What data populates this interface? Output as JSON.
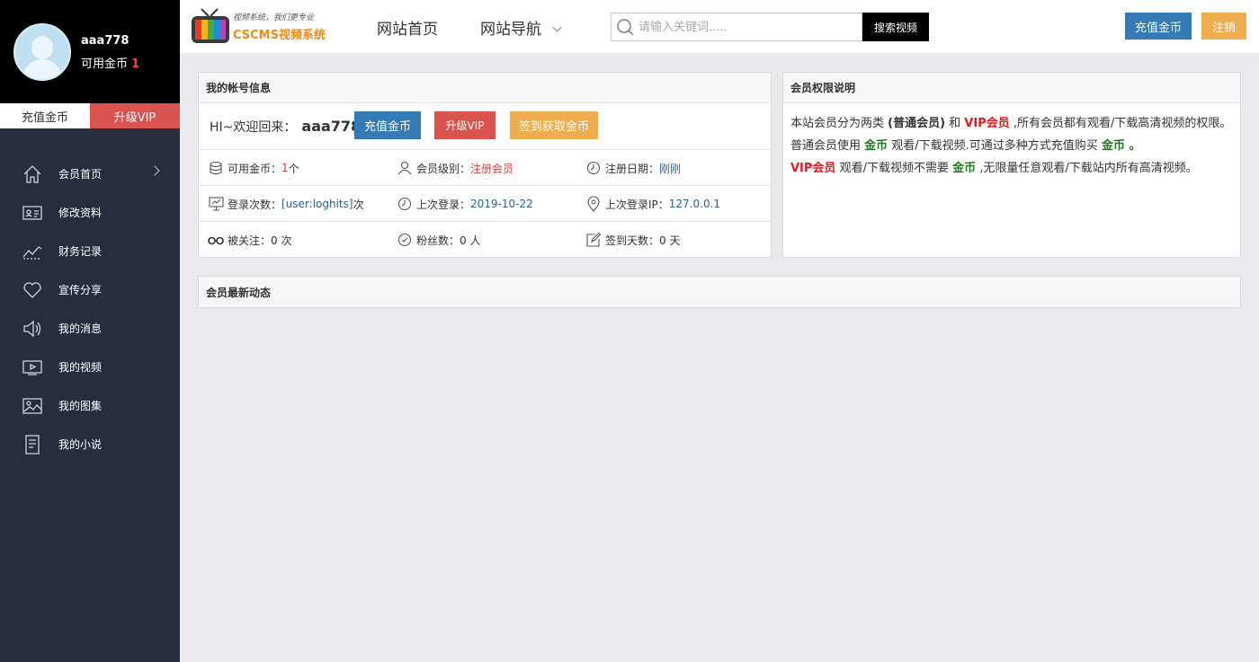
{
  "sidebar": {
    "username": "aaa778",
    "coins_label": "可用金币",
    "coins_value": "1",
    "recharge_label": "充值金币",
    "vip_label": "升级VIP",
    "items": [
      {
        "label": "会员首页",
        "icon": "home-icon"
      },
      {
        "label": "修改资料",
        "icon": "id-card-icon"
      },
      {
        "label": "财务记录",
        "icon": "trend-icon"
      },
      {
        "label": "宣传分享",
        "icon": "heart-icon"
      },
      {
        "label": "我的消息",
        "icon": "speaker-icon"
      },
      {
        "label": "我的视频",
        "icon": "video-icon"
      },
      {
        "label": "我的图集",
        "icon": "image-icon"
      },
      {
        "label": "我的小说",
        "icon": "book-icon"
      }
    ]
  },
  "header": {
    "logo_slogan": "视频系统，我们更专业",
    "logo_brand": "CSCMS视频系统",
    "nav_home": "网站首页",
    "nav_guide": "网站导航",
    "search_placeholder": "请输入关键词.....",
    "search_button": "搜索视频",
    "recharge_button": "充值金币",
    "logout_button": "注销"
  },
  "account": {
    "title": "我的帐号信息",
    "greeting": "HI~欢迎回来：",
    "username": "aaa778",
    "recharge_button": "充值金币",
    "vip_button": "升级VIP",
    "sign_button": "签到获取金币",
    "coins_label": "可用金币：",
    "coins_value": "1",
    "coins_unit": " 个",
    "level_label": "会员级别：",
    "level_value": "注册会员",
    "reg_label": "注册日期：",
    "reg_value": "刚刚",
    "logins_label": "登录次数：",
    "logins_value": "[user:loghits]",
    "logins_unit": " 次",
    "last_login_label": "上次登录：",
    "last_login_value": "2019-10-22",
    "last_ip_label": "上次登录IP：",
    "last_ip_value": "127.0.0.1",
    "followed_label": "被关注：",
    "followed_value": "0 次",
    "fans_label": "粉丝数：",
    "fans_value": " 0 人",
    "signdays_label": "签到天数：",
    "signdays_value": "0 天"
  },
  "perm": {
    "title": "会员权限说明",
    "l1_a": "本站会员分为两类 ",
    "l1_b": "(普通会员)",
    "l1_c": " 和 ",
    "l1_d": "VIP会员",
    "l1_e": " ,所有会员都有观看/下载高清视频的权限。",
    "l2_a": "普通会员使用 ",
    "l2_b": "金币",
    "l2_c": " 观看/下载视频.可通过多种方式充值购买 ",
    "l2_d": "金币 。",
    "l3_a": "VIP会员",
    "l3_b": " 观看/下载视频不需要 ",
    "l3_c": "金币",
    "l3_d": " ,无限量任意观看/下载站内所有高清视频。"
  },
  "news": {
    "title": "会员最新动态"
  }
}
